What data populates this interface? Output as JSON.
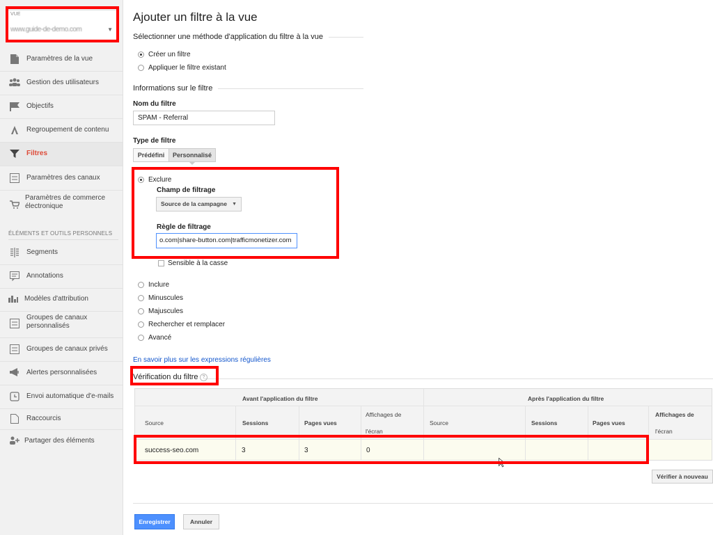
{
  "sidebar": {
    "view_label": "VUE",
    "view_value": "www.guide-de-demo.com",
    "items": [
      {
        "label": "Paramètres de la vue",
        "icon": "document-icon"
      },
      {
        "label": "Gestion des utilisateurs",
        "icon": "users-icon"
      },
      {
        "label": "Objectifs",
        "icon": "flag-icon"
      },
      {
        "label": "Regroupement de contenu",
        "icon": "person-run-icon"
      },
      {
        "label": "Filtres",
        "icon": "filter-icon"
      },
      {
        "label": "Paramètres des canaux",
        "icon": "channel-icon"
      },
      {
        "label": "Paramètres de commerce électronique",
        "icon": "cart-icon"
      }
    ],
    "section_header": "ÉLÉMENTS ET OUTILS PERSONNELS",
    "personal_items": [
      {
        "label": "Segments",
        "icon": "segments-icon"
      },
      {
        "label": "Annotations",
        "icon": "annotation-icon"
      },
      {
        "label": "Modèles d'attribution",
        "icon": "bar-chart-icon"
      },
      {
        "label": "Groupes de canaux personnalisés",
        "icon": "channel-group-icon"
      },
      {
        "label": "Groupes de canaux privés",
        "icon": "private-channel-icon"
      },
      {
        "label": "Alertes personnalisées",
        "icon": "megaphone-icon"
      },
      {
        "label": "Envoi automatique d'e-mails",
        "icon": "clock-icon"
      },
      {
        "label": "Raccourcis",
        "icon": "shortcut-icon"
      },
      {
        "label": "Partager des éléments",
        "icon": "share-user-icon"
      }
    ]
  },
  "main": {
    "title": "Ajouter un filtre à la vue",
    "method_section": "Sélectionner une méthode d'application du filtre à la vue",
    "method_create": "Créer un filtre",
    "method_existing": "Appliquer le filtre existant",
    "info_section": "Informations sur le filtre",
    "name_label": "Nom du filtre",
    "name_value": "SPAM - Referral",
    "type_label": "Type de filtre",
    "type_predef": "Prédéfini",
    "type_custom": "Personnalisé",
    "exclude": "Exclure",
    "field_label": "Champ de filtrage",
    "field_value": "Source de la campagne",
    "rule_label": "Règle de filtrage",
    "rule_value": "o.com|share-button.com|trafficmonetizer.com",
    "case_sensitive": "Sensible à la casse",
    "options": [
      "Inclure",
      "Minuscules",
      "Majuscules",
      "Rechercher et remplacer",
      "Avancé"
    ],
    "regex_link": "En savoir plus sur les expressions régulières",
    "verify_title": "Vérification du filtre",
    "help_glyph": "?",
    "table": {
      "before_header": "Avant l'application du filtre",
      "after_header": "Après l'application du filtre",
      "col_source": "Source",
      "col_sessions": "Sessions",
      "col_pages": "Pages vues",
      "col_screen_1": "Affichages de",
      "col_screen_2": "l'écran",
      "row": {
        "source": "success-seo.com",
        "sessions": "3",
        "pages": "3",
        "screen": "0"
      }
    },
    "verify_again": "Vérifier à nouveau",
    "save": "Enregistrer",
    "cancel": "Annuler"
  }
}
